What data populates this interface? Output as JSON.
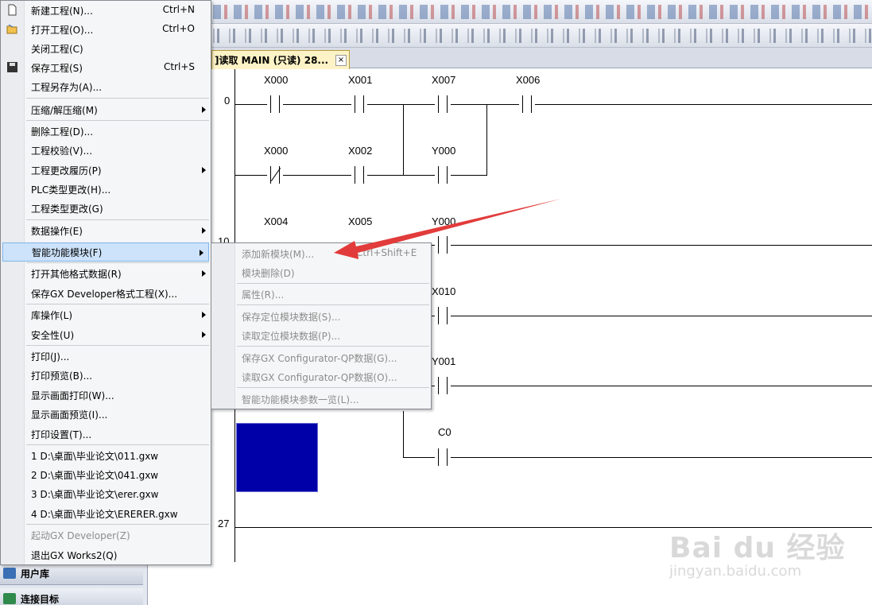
{
  "document_tab": {
    "title": "]读取 MAIN (只读) 28...",
    "close": "×"
  },
  "ladder": {
    "steps": [
      "0",
      "10",
      "27"
    ],
    "contacts": [
      "X000",
      "X001",
      "X007",
      "X006",
      "X000",
      "X002",
      "Y000",
      "X004",
      "X005",
      "Y000",
      "X010",
      "Y001",
      "C0"
    ]
  },
  "file_menu": {
    "items": [
      {
        "label": "新建工程(N)...",
        "shortcut": "Ctrl+N"
      },
      {
        "label": "打开工程(O)...",
        "shortcut": "Ctrl+O"
      },
      {
        "label": "关闭工程(C)",
        "shortcut": ""
      },
      {
        "label": "保存工程(S)",
        "shortcut": "Ctrl+S"
      },
      {
        "label": "工程另存为(A)...",
        "shortcut": ""
      },
      {
        "label": "压缩/解压缩(M)",
        "shortcut": ""
      },
      {
        "label": "删除工程(D)...",
        "shortcut": ""
      },
      {
        "label": "工程校验(V)...",
        "shortcut": ""
      },
      {
        "label": "工程更改履历(P)",
        "shortcut": ""
      },
      {
        "label": "PLC类型更改(H)...",
        "shortcut": ""
      },
      {
        "label": "工程类型更改(G)",
        "shortcut": ""
      },
      {
        "label": "数据操作(E)",
        "shortcut": ""
      },
      {
        "label": "智能功能模块(F)",
        "shortcut": ""
      },
      {
        "label": "打开其他格式数据(R)",
        "shortcut": ""
      },
      {
        "label": "保存GX Developer格式工程(X)...",
        "shortcut": ""
      },
      {
        "label": "库操作(L)",
        "shortcut": ""
      },
      {
        "label": "安全性(U)",
        "shortcut": ""
      },
      {
        "label": "打印(J)...",
        "shortcut": ""
      },
      {
        "label": "打印预览(B)...",
        "shortcut": ""
      },
      {
        "label": "显示画面打印(W)...",
        "shortcut": ""
      },
      {
        "label": "显示画面预览(I)...",
        "shortcut": ""
      },
      {
        "label": "打印设置(T)...",
        "shortcut": ""
      },
      {
        "label": "1 D:\\桌面\\毕业论文\\011.gxw",
        "shortcut": ""
      },
      {
        "label": "2 D:\\桌面\\毕业论文\\041.gxw",
        "shortcut": ""
      },
      {
        "label": "3 D:\\桌面\\毕业论文\\erer.gxw",
        "shortcut": ""
      },
      {
        "label": "4 D:\\桌面\\毕业论文\\ERERER.gxw",
        "shortcut": ""
      },
      {
        "label": "起动GX Developer(Z)",
        "shortcut": ""
      },
      {
        "label": "退出GX Works2(Q)",
        "shortcut": ""
      }
    ]
  },
  "sub_menu": {
    "items": [
      {
        "label": "添加新模块(M)...",
        "shortcut": "Ctrl+Shift+E"
      },
      {
        "label": "模块删除(D)",
        "shortcut": ""
      },
      {
        "label": "属性(R)...",
        "shortcut": ""
      },
      {
        "label": "保存定位模块数据(S)...",
        "shortcut": ""
      },
      {
        "label": "读取定位模块数据(P)...",
        "shortcut": ""
      },
      {
        "label": "保存GX Configurator-QP数据(G)...",
        "shortcut": ""
      },
      {
        "label": "读取GX Configurator-QP数据(O)...",
        "shortcut": ""
      },
      {
        "label": "智能功能模块参数一览(L)...",
        "shortcut": ""
      }
    ]
  },
  "left_panel": {
    "items": [
      "用户库",
      "连接目标"
    ]
  },
  "watermark": {
    "brand": "Bai du 经验",
    "url": "jingyan.baidu.com"
  },
  "colors": {
    "menu_highlight": "#cde3fb",
    "tab_active": "#fdf3c6",
    "block_fill": "#0000a8",
    "arrow": "#e23b3b"
  }
}
